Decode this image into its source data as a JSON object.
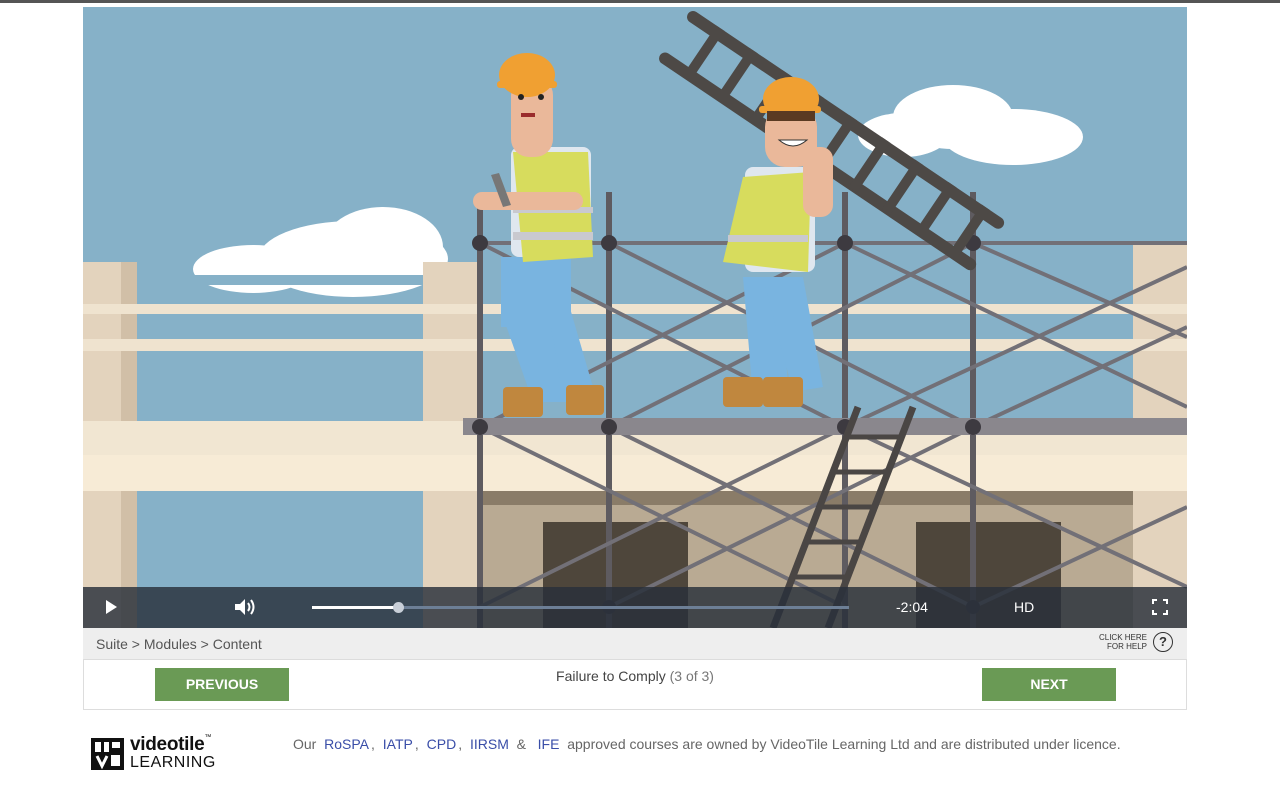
{
  "player": {
    "time_remaining": "-2:04",
    "quality_label": "HD",
    "progress": 0.16,
    "buffered": 0.99
  },
  "breadcrumb": {
    "text": "Suite > Modules > Content"
  },
  "help": {
    "line1": "CLICK HERE",
    "line2": "FOR HELP",
    "icon_glyph": "?"
  },
  "navigation": {
    "previous_label": "PREVIOUS",
    "next_label": "NEXT",
    "lesson_title": "Failure to Comply",
    "lesson_count": "(3 of 3)"
  },
  "logo": {
    "word": "videotile",
    "tm": "™",
    "sub": "LEARNING"
  },
  "footer": {
    "prefix": "Our",
    "links": [
      "RoSPA",
      "IATP",
      "CPD",
      "IIRSM",
      "IFE"
    ],
    "comma": ",",
    "ampersand": "&",
    "suffix": "approved courses are owned by VideoTile Learning Ltd and are distributed under licence."
  },
  "colors": {
    "button_green": "#6a9a55",
    "link_blue": "#3a4ea8",
    "sky": "#86b1c8"
  },
  "icons": [
    "play-icon",
    "volume-icon",
    "fullscreen-icon",
    "help-icon"
  ]
}
